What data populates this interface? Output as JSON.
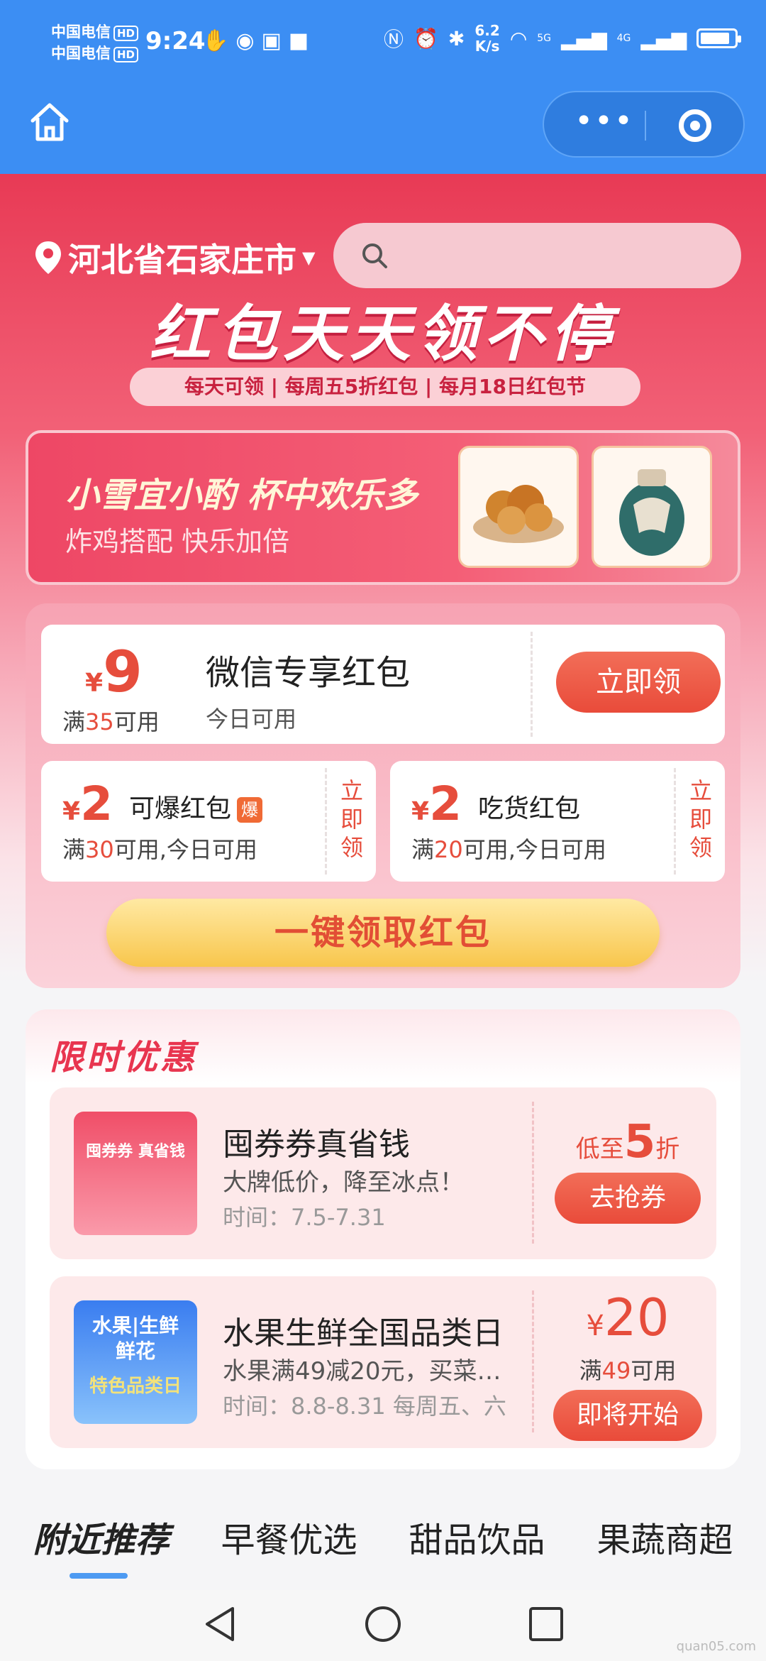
{
  "status_bar": {
    "carrier1": "中国电信",
    "carrier2": "中国电信",
    "hd": "HD",
    "time": "9:24",
    "speed_value": "6.2",
    "speed_unit": "K/s",
    "signal1_label": "5G",
    "signal2_label": "4G"
  },
  "hero": {
    "location": "河北省石家庄市",
    "headline": "红包天天领不停",
    "subline": "每天可领 | 每周五5折红包 | 每月18日红包节"
  },
  "banner": {
    "title": "小雪宜小酌 杯中欢乐多",
    "subtitle": "炸鸡搭配 快乐加倍"
  },
  "coupons": {
    "main": {
      "currency": "¥",
      "amount": "9",
      "cond_pre": "满",
      "cond_num": "35",
      "cond_post": "可用",
      "title": "微信专享红包",
      "subtitle": "今日可用",
      "button": "立即领"
    },
    "left": {
      "currency": "¥",
      "amount": "2",
      "name": "可爆红包",
      "badge": "爆",
      "cond_pre": "满",
      "cond_num": "30",
      "cond_post": "可用,今日可用",
      "button": "立即领"
    },
    "right": {
      "currency": "¥",
      "amount": "2",
      "name": "吃货红包",
      "cond_pre": "满",
      "cond_num": "20",
      "cond_post": "可用,今日可用",
      "button": "立即领"
    },
    "one_key_button": "一键领取红包"
  },
  "limited": {
    "title": "限时优惠",
    "offers": [
      {
        "thumb_text1": "囤券券 真省钱",
        "title": "囤券券真省钱",
        "desc": "大牌低价，降至冰点！",
        "time": "时间：7.5-7.31",
        "discount_pre": "低至",
        "discount_num": "5",
        "discount_post": "折",
        "button": "去抢券"
      },
      {
        "thumb_text1": "水果|生鲜",
        "thumb_text2": "鲜花",
        "thumb_text3": "特色品类日",
        "title": "水果生鲜全国品类日",
        "desc": "水果满49减20元，买菜…",
        "time": "时间：8.8-8.31 每周五、六",
        "currency": "¥",
        "amount": "20",
        "cond_pre": "满",
        "cond_num": "49",
        "cond_post": "可用",
        "button": "即将开始"
      }
    ]
  },
  "tabs": [
    "附近推荐",
    "早餐优选",
    "甜品饮品",
    "果蔬商超"
  ],
  "watermark": "quan05.com"
}
